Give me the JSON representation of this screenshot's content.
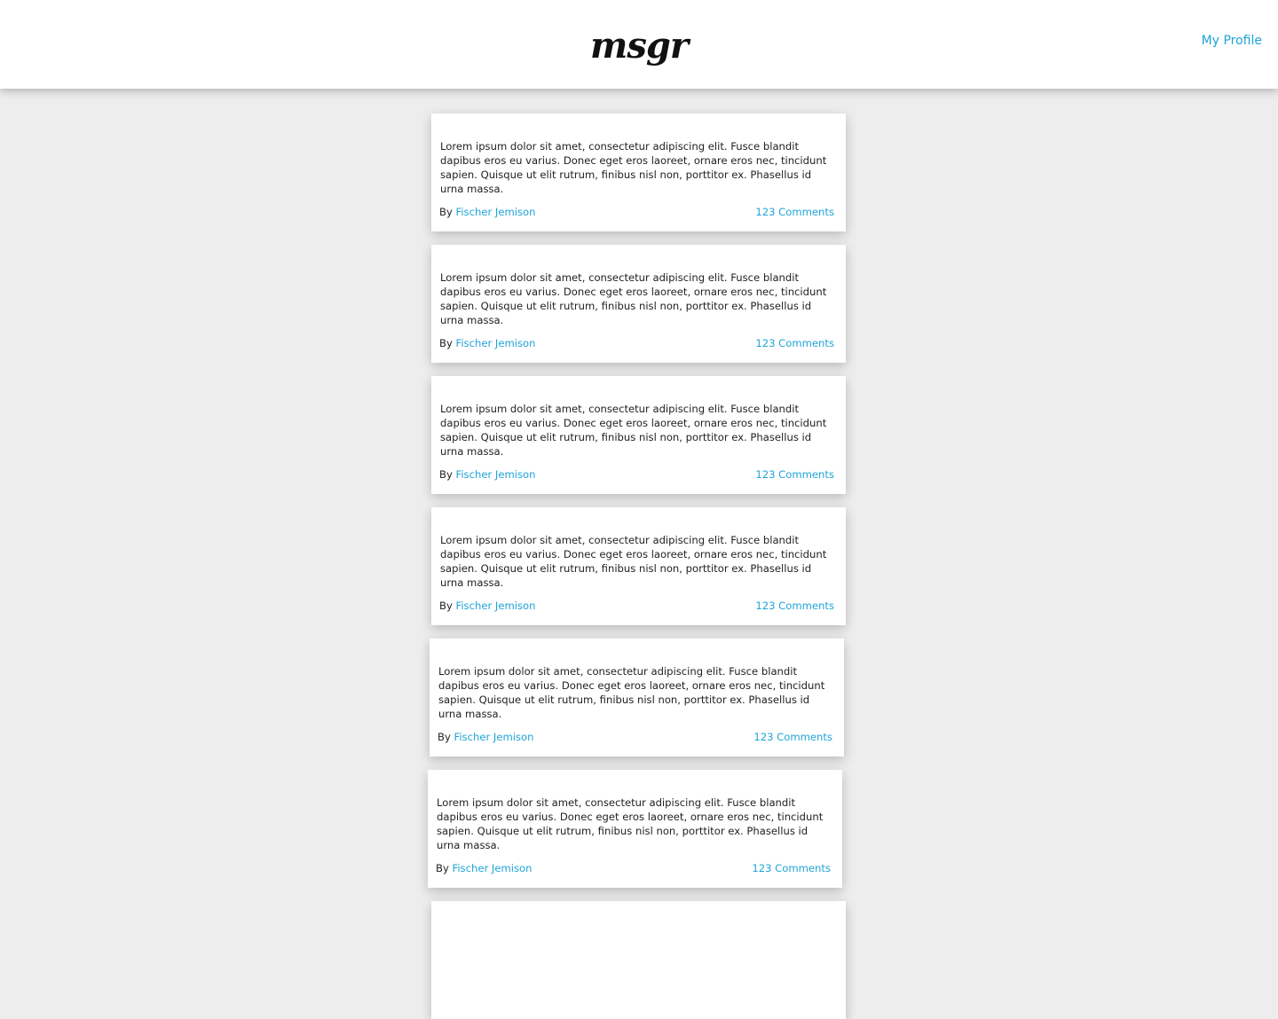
{
  "header": {
    "logo": "msgr",
    "profile_link": "My Profile"
  },
  "colors": {
    "accent": "#1fa4d8",
    "background": "#ededed",
    "card": "#ffffff"
  },
  "posts": [
    {
      "body": "Lorem ipsum dolor sit amet, consectetur adipiscing elit. Fusce blandit dapibus eros eu varius. Donec eget eros laoreet, ornare eros nec, tincidunt sapien. Quisque ut elit rutrum, finibus nisl non, porttitor ex. Phasellus id urna massa.",
      "by_label": "By",
      "author": "Fischer Jemison",
      "comments": "123 Comments"
    },
    {
      "body": "Lorem ipsum dolor sit amet, consectetur adipiscing elit. Fusce blandit dapibus eros eu varius. Donec eget eros laoreet, ornare eros nec, tincidunt sapien. Quisque ut elit rutrum, finibus nisl non, porttitor ex. Phasellus id urna massa.",
      "by_label": "By",
      "author": "Fischer Jemison",
      "comments": "123 Comments"
    },
    {
      "body": "Lorem ipsum dolor sit amet, consectetur adipiscing elit. Fusce blandit dapibus eros eu varius. Donec eget eros laoreet, ornare eros nec, tincidunt sapien. Quisque ut elit rutrum, finibus nisl non, porttitor ex. Phasellus id urna massa.",
      "by_label": "By",
      "author": "Fischer Jemison",
      "comments": "123 Comments"
    },
    {
      "body": "Lorem ipsum dolor sit amet, consectetur adipiscing elit. Fusce blandit dapibus eros eu varius. Donec eget eros laoreet, ornare eros nec, tincidunt sapien. Quisque ut elit rutrum, finibus nisl non, porttitor ex. Phasellus id urna massa.",
      "by_label": "By",
      "author": "Fischer Jemison",
      "comments": "123 Comments"
    },
    {
      "body": "Lorem ipsum dolor sit amet, consectetur adipiscing elit. Fusce blandit dapibus eros eu varius. Donec eget eros laoreet, ornare eros nec, tincidunt sapien. Quisque ut elit rutrum, finibus nisl non, porttitor ex. Phasellus id urna massa.",
      "by_label": "By",
      "author": "Fischer Jemison",
      "comments": "123 Comments"
    },
    {
      "body": "Lorem ipsum dolor sit amet, consectetur adipiscing elit. Fusce blandit dapibus eros eu varius. Donec eget eros laoreet, ornare eros nec, tincidunt sapien. Quisque ut elit rutrum, finibus nisl non, porttitor ex. Phasellus id urna massa.",
      "by_label": "By",
      "author": "Fischer Jemison",
      "comments": "123 Comments"
    },
    {
      "body": "",
      "by_label": "",
      "author": "",
      "comments": ""
    }
  ]
}
